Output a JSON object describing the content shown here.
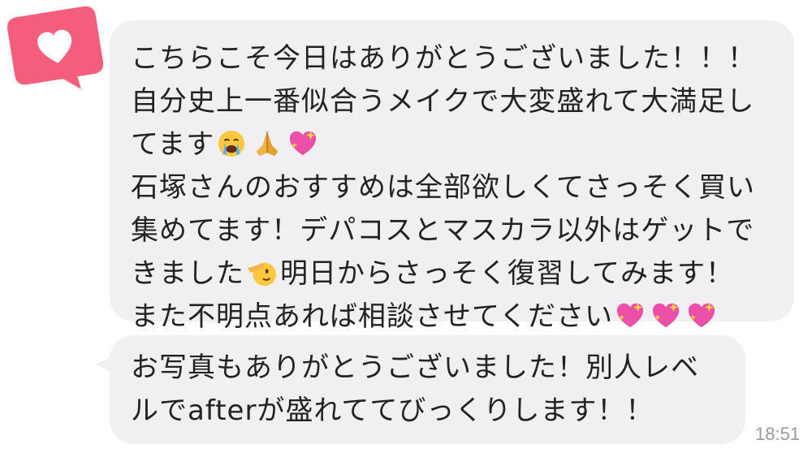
{
  "avatar": {
    "icon": "heart-icon",
    "color": "#f45e7c"
  },
  "messages": [
    {
      "lines": [
        "こちらこそ今日はありがとうございました！！！",
        "自分史上一番似合うメイクで大変盛れて大満足し",
        "てます",
        "石塚さんのおすすめは全部欲しくてさっそく買い",
        "集めてます！デパコスとマスカラ以外はゲットで",
        "きました",
        "明日からさっそく復習してみます！",
        "また不明点あれば相談させてください"
      ],
      "emojis": {
        "line3": [
          "crying-face-emoji",
          "folded-hands-emoji",
          "sparkling-heart-emoji"
        ],
        "line6": [
          "salute-face-emoji"
        ],
        "line8": [
          "sparkling-heart-emoji",
          "sparkling-heart-emoji",
          "sparkling-heart-emoji"
        ]
      }
    },
    {
      "lines": [
        "お写真もありがとうございました！別人レベ",
        "ルでafterが盛れててびっくりします！！"
      ]
    }
  ],
  "timestamp": "18:51",
  "colors": {
    "bubble": "#f0f0f3",
    "text": "#222222",
    "timestamp": "#9a9a9a",
    "heart_badge": "#f45e7c"
  }
}
